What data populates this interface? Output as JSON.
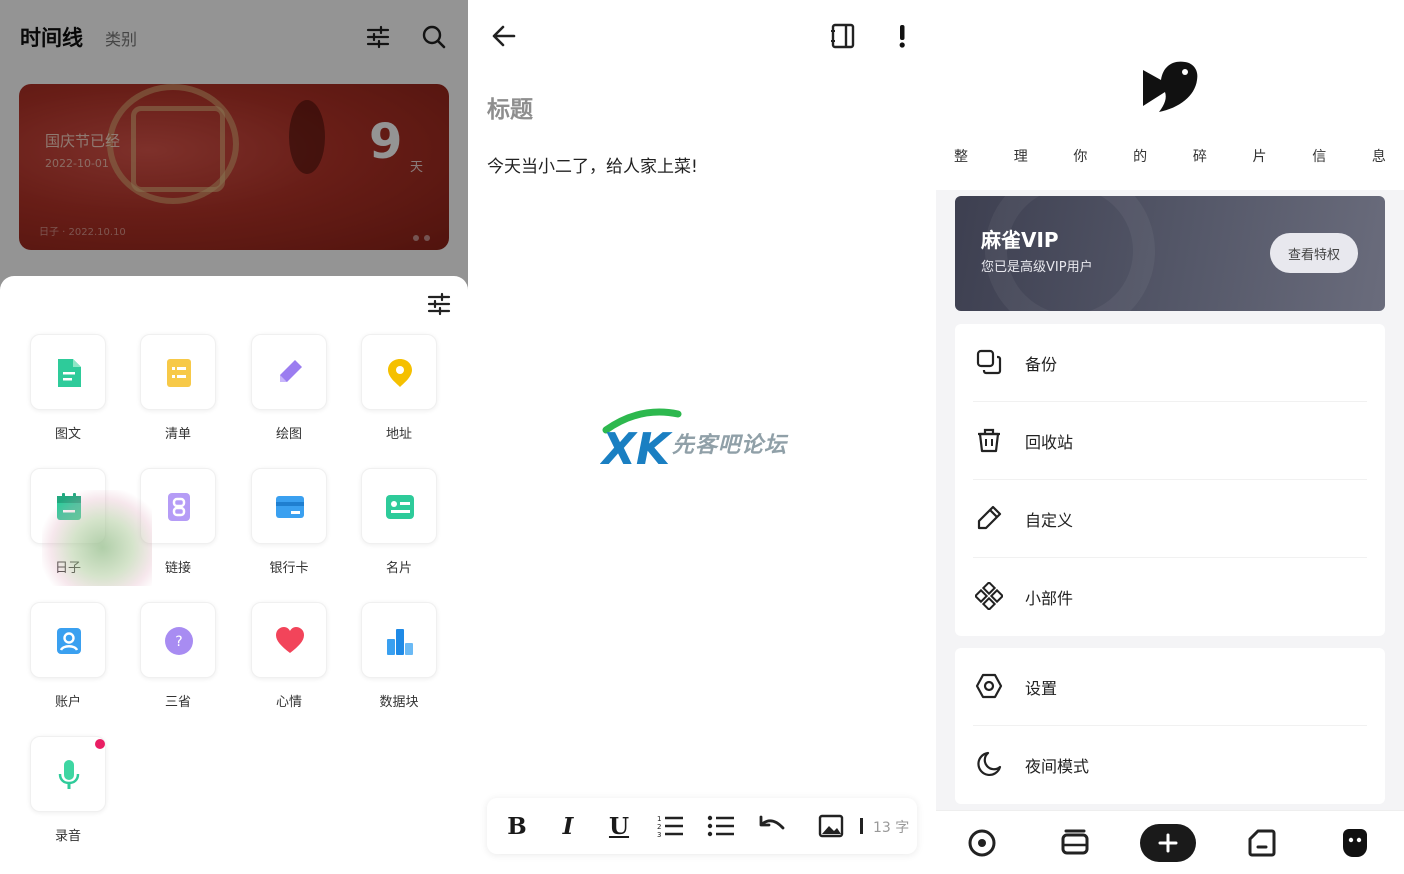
{
  "left": {
    "header": {
      "title": "时间线",
      "tab": "类别"
    },
    "event_card": {
      "name": "国庆节已经",
      "date": "2022-10-01",
      "count": "9",
      "unit": "天",
      "footer": "日子 · 2022.10.10"
    },
    "tiles": [
      {
        "label": "图文",
        "icon": "note-icon",
        "color": "#2ecb9a"
      },
      {
        "label": "清单",
        "icon": "checklist-icon",
        "color": "#f7c948"
      },
      {
        "label": "绘图",
        "icon": "pencil-icon",
        "color": "#9b7df0"
      },
      {
        "label": "地址",
        "icon": "location-icon",
        "color": "#f5b400"
      },
      {
        "label": "日子",
        "icon": "calendar-icon",
        "color": "#2ecb9a"
      },
      {
        "label": "链接",
        "icon": "link-icon",
        "color": "#9b7df0"
      },
      {
        "label": "银行卡",
        "icon": "card-icon",
        "color": "#3aa0f0"
      },
      {
        "label": "名片",
        "icon": "business-card-icon",
        "color": "#2ecb9a"
      },
      {
        "label": "账户",
        "icon": "account-icon",
        "color": "#3aa0f0"
      },
      {
        "label": "三省",
        "icon": "question-icon",
        "color": "#a88cf2"
      },
      {
        "label": "心情",
        "icon": "heart-icon",
        "color": "#f2445a"
      },
      {
        "label": "数据块",
        "icon": "bar-chart-icon",
        "color": "#3aa0f0"
      },
      {
        "label": "录音",
        "icon": "microphone-icon",
        "color": "#2ecb9a"
      }
    ]
  },
  "middle": {
    "note": {
      "title": "标题",
      "body": "今天当小二了，给人家上菜!"
    },
    "watermark": {
      "logo": "XK",
      "text": "先客吧论坛"
    },
    "toolbar": {
      "bold": "B",
      "italic": "I",
      "underline": "U",
      "word_count": "13 字"
    }
  },
  "right": {
    "slogan": [
      "整",
      "理",
      "你",
      "的",
      "碎",
      "片",
      "信",
      "息"
    ],
    "vip": {
      "title": "麻雀VIP",
      "subtitle": "您已是高级VIP用户",
      "button": "查看特权"
    },
    "menu_group_1": [
      {
        "label": "备份",
        "icon": "backup-icon"
      },
      {
        "label": "回收站",
        "icon": "trash-icon"
      },
      {
        "label": "自定义",
        "icon": "edit-icon"
      },
      {
        "label": "小部件",
        "icon": "widget-icon"
      }
    ],
    "menu_group_2": [
      {
        "label": "设置",
        "icon": "settings-icon"
      },
      {
        "label": "夜间模式",
        "icon": "moon-icon"
      }
    ]
  }
}
